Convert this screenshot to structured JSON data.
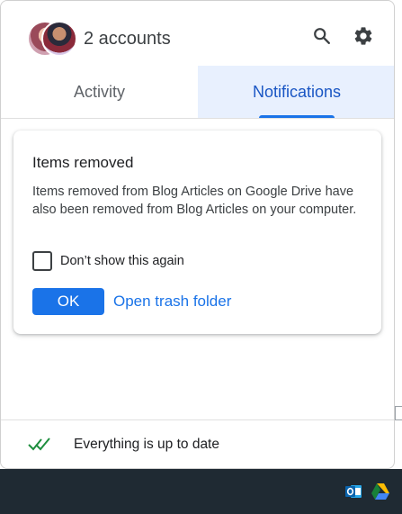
{
  "header": {
    "accounts_label": "2 accounts",
    "icons": {
      "search": "search-icon",
      "settings": "gear-icon"
    }
  },
  "tabs": [
    {
      "label": "Activity",
      "active": false
    },
    {
      "label": "Notifications",
      "active": true
    }
  ],
  "notification": {
    "title": "Items removed",
    "body": "Items removed from Blog Articles on Google Drive have also been removed from Blog Articles on your computer.",
    "checkbox_label": "Don’t show this again",
    "checkbox_checked": false,
    "ok_label": "OK",
    "link_label": "Open trash folder"
  },
  "footer": {
    "status_text": "Everything is up to date",
    "status_icon": "double-check-icon"
  },
  "taskbar": {
    "tray_icons": [
      "outlook-icon",
      "google-drive-icon"
    ]
  },
  "colors": {
    "accent": "#1a73e8",
    "tab_active_bg": "#e8f0fe",
    "status_check": "#1e8e3e",
    "taskbar_bg": "#1f2a33"
  }
}
